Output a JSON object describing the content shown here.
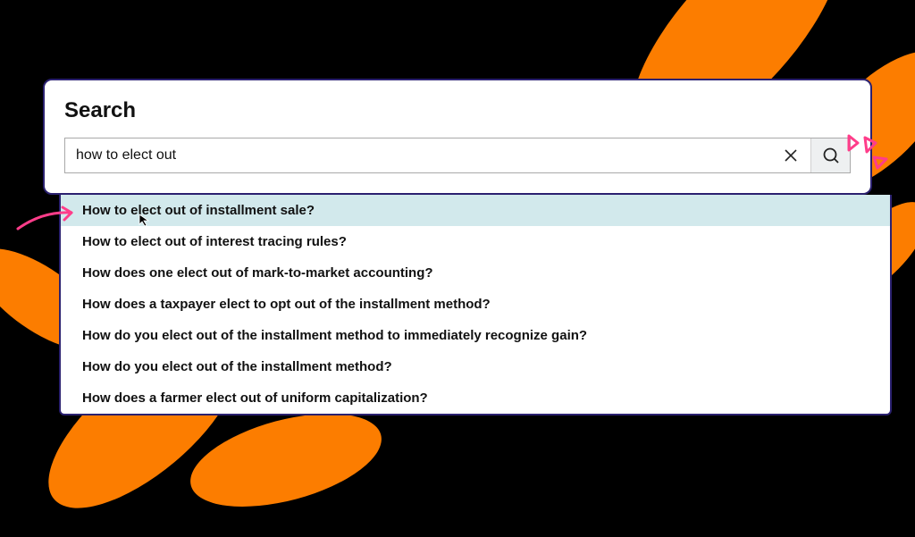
{
  "panel": {
    "title": "Search"
  },
  "search": {
    "value": "how to elect out",
    "placeholder": ""
  },
  "suggestions": {
    "0": "How to elect out of installment sale?",
    "1": "How to elect out of interest tracing rules?",
    "2": "How does one elect out of mark-to-market accounting?",
    "3": "How does a taxpayer elect to opt out of the installment method?",
    "4": "How do you elect out of the installment method to immediately recognize gain?",
    "5": "How do you elect out of the installment method?",
    "6": "How does a farmer elect out of uniform capitalization?"
  },
  "colors": {
    "accent_orange": "#fc7d00",
    "accent_pink": "#ff3d8a",
    "panel_border": "#2b2170",
    "highlight": "#d2e9ec"
  }
}
